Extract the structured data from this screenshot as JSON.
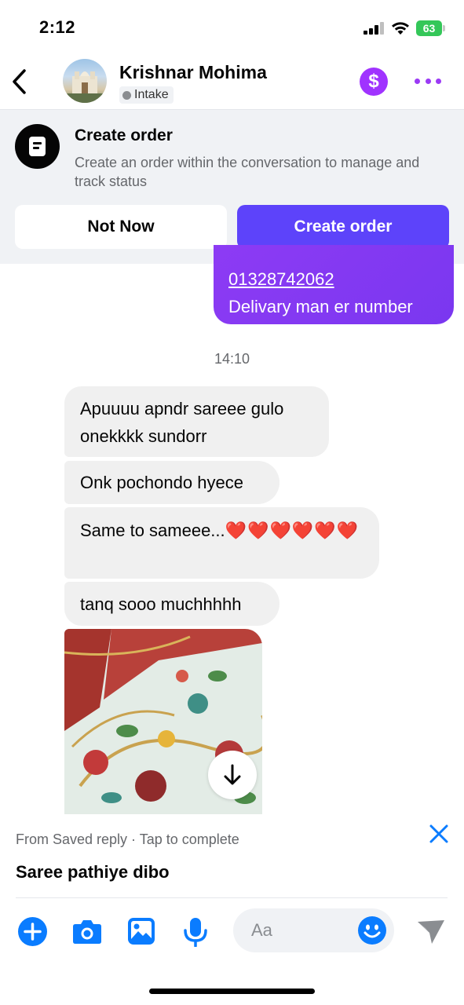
{
  "status_bar": {
    "time": "2:12",
    "battery": "63"
  },
  "header": {
    "contact_name": "Krishnar Mohima",
    "contact_status": "Intake",
    "icons": [
      "back-icon",
      "avatar",
      "dollar-icon",
      "more-icon"
    ]
  },
  "order_banner": {
    "title": "Create order",
    "description": "Create an order within the conversation to manage and track status",
    "not_now_label": "Not Now",
    "create_label": "Create order"
  },
  "chat": {
    "outgoing": {
      "phone": "01328742062",
      "text": "Delivary man er number"
    },
    "timestamp": "14:10",
    "incoming": [
      {
        "text": "Apuuuu apndr sareee gulo onekkkk sundorr"
      },
      {
        "text": "Onk pochondo hyece"
      },
      {
        "text": "Same to sameee...",
        "emoji": "❤️❤️❤️❤️❤️❤️"
      },
      {
        "text": "tanq sooo muchhhhh"
      }
    ],
    "photo_icon": "scroll-down-arrow-icon"
  },
  "saved_reply": {
    "hint": "From Saved reply · Tap to complete",
    "text": "Saree pathiye dibo"
  },
  "composer": {
    "placeholder": "Aa",
    "icons": [
      "plus-icon",
      "camera-icon",
      "gallery-icon",
      "microphone-icon",
      "emoji-icon",
      "send-icon"
    ]
  },
  "colors": {
    "accent_blue": "#0a7cff",
    "outgoing_bubble": "#8d3bf4",
    "create_button": "#5d43fa",
    "dollar_badge": "#a033ff"
  }
}
